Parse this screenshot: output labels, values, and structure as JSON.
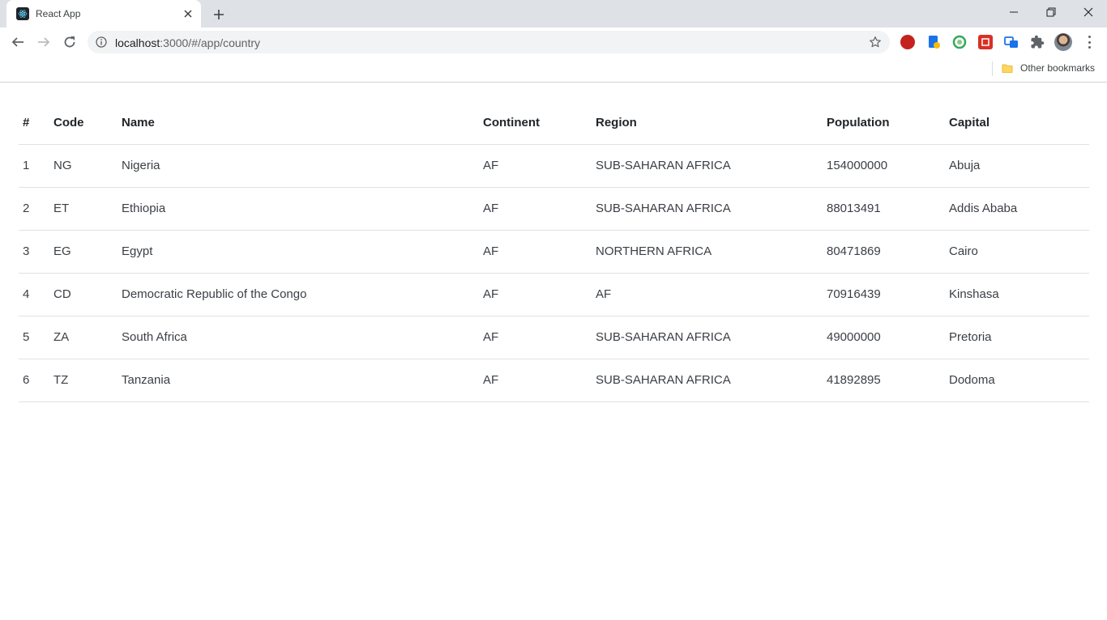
{
  "browser": {
    "tab_title": "React App",
    "url_host": "localhost",
    "url_rest": ":3000/#/app/country",
    "bookmarks_label": "Other bookmarks",
    "extension_icons": [
      "extension-red-icon",
      "extension-blue-doc-icon",
      "extension-green-circle-icon",
      "extension-red-square-icon",
      "extension-blue-arrows-icon",
      "puzzle-icon"
    ]
  },
  "table": {
    "headers": [
      "#",
      "Code",
      "Name",
      "Continent",
      "Region",
      "Population",
      "Capital"
    ],
    "rows": [
      [
        "1",
        "NG",
        "Nigeria",
        "AF",
        "SUB-SAHARAN AFRICA",
        "154000000",
        "Abuja"
      ],
      [
        "2",
        "ET",
        "Ethiopia",
        "AF",
        "SUB-SAHARAN AFRICA",
        "88013491",
        "Addis Ababa"
      ],
      [
        "3",
        "EG",
        "Egypt",
        "AF",
        "NORTHERN AFRICA",
        "80471869",
        "Cairo"
      ],
      [
        "4",
        "CD",
        "Democratic Republic of the Congo",
        "AF",
        "AF",
        "70916439",
        "Kinshasa"
      ],
      [
        "5",
        "ZA",
        "South Africa",
        "AF",
        "SUB-SAHARAN AFRICA",
        "49000000",
        "Pretoria"
      ],
      [
        "6",
        "TZ",
        "Tanzania",
        "AF",
        "SUB-SAHARAN AFRICA",
        "41892895",
        "Dodoma"
      ]
    ]
  },
  "colors": {
    "tabstrip": "#dee1e6",
    "omnibox": "#f1f3f4",
    "row_border": "#dee2e6"
  }
}
